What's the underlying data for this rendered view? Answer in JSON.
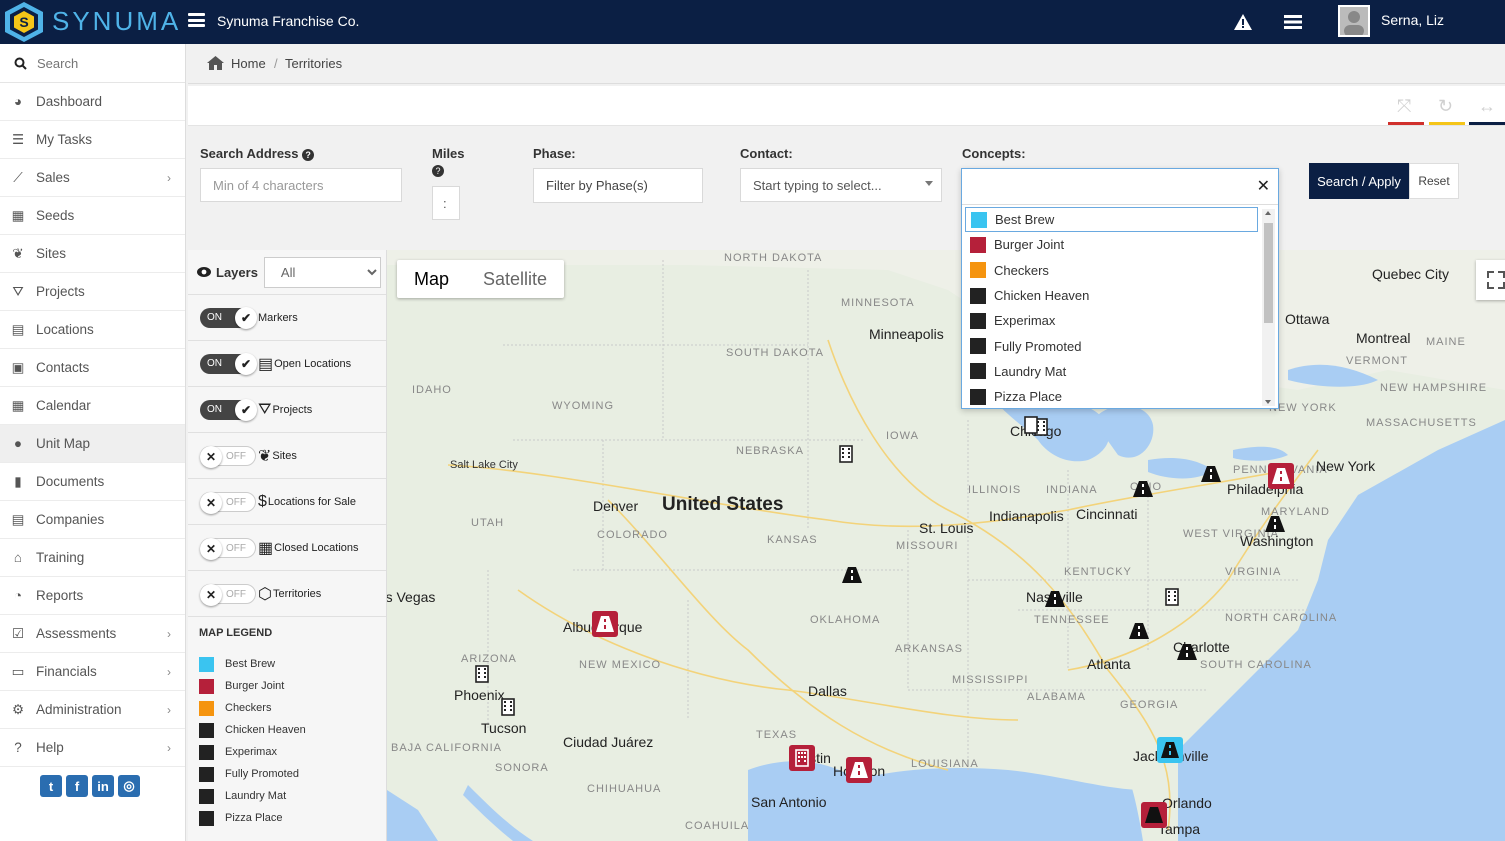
{
  "app": {
    "logo_text": "SYNUMA",
    "company": "Synuma Franchise Co.",
    "user": "Serna, Liz"
  },
  "sidebar": {
    "search_placeholder": "Search",
    "items": [
      {
        "label": "Dashboard",
        "icon": "dashboard-icon"
      },
      {
        "label": "My Tasks",
        "icon": "tasks-icon"
      },
      {
        "label": "Sales",
        "icon": "chart-line-icon",
        "chevron": true
      },
      {
        "label": "Seeds",
        "icon": "grid-icon"
      },
      {
        "label": "Sites",
        "icon": "leaf-icon"
      },
      {
        "label": "Projects",
        "icon": "road-icon"
      },
      {
        "label": "Locations",
        "icon": "building-icon"
      },
      {
        "label": "Contacts",
        "icon": "contact-icon"
      },
      {
        "label": "Calendar",
        "icon": "calendar-icon"
      },
      {
        "label": "Unit Map",
        "icon": "globe-icon",
        "active": true
      },
      {
        "label": "Documents",
        "icon": "file-icon"
      },
      {
        "label": "Companies",
        "icon": "building-icon"
      },
      {
        "label": "Training",
        "icon": "graduation-cap-icon"
      },
      {
        "label": "Reports",
        "icon": "pie-chart-icon"
      },
      {
        "label": "Assessments",
        "icon": "check-square-icon",
        "chevron": true
      },
      {
        "label": "Financials",
        "icon": "money-icon",
        "chevron": true
      },
      {
        "label": "Administration",
        "icon": "cogs-icon",
        "chevron": true
      },
      {
        "label": "Help",
        "icon": "question-icon",
        "chevron": true
      }
    ],
    "social": [
      "twitter-icon",
      "facebook-icon",
      "linkedin-icon",
      "instagram-icon"
    ]
  },
  "breadcrumb": {
    "home": "Home",
    "current": "Territories"
  },
  "filters": {
    "search_address": {
      "label": "Search Address",
      "placeholder": "Min of 4 characters"
    },
    "miles": {
      "label": "Miles",
      "value": ":"
    },
    "phase": {
      "label": "Phase:",
      "placeholder": "Filter by Phase(s)"
    },
    "contact": {
      "label": "Contact:",
      "placeholder": "Start typing to select..."
    },
    "concepts": {
      "label": "Concepts:",
      "value": ""
    },
    "apply_label": "Search / Apply",
    "reset_label": "Reset"
  },
  "concepts_dropdown": [
    {
      "label": "Best Brew",
      "color": "#3ac4f0",
      "selected": true
    },
    {
      "label": "Burger Joint",
      "color": "#b5203a"
    },
    {
      "label": "Checkers",
      "color": "#f5940f"
    },
    {
      "label": "Chicken Heaven",
      "color": "#222222"
    },
    {
      "label": "Experimax",
      "color": "#222222"
    },
    {
      "label": "Fully Promoted",
      "color": "#222222"
    },
    {
      "label": "Laundry Mat",
      "color": "#222222"
    },
    {
      "label": "Pizza Place",
      "color": "#222222"
    }
  ],
  "layers": {
    "title": "Layers",
    "filter_value": "All",
    "on_text": "ON",
    "off_text": "OFF",
    "rows": [
      {
        "label": "Markers",
        "on": true,
        "icon": ""
      },
      {
        "label": "Open Locations",
        "on": true,
        "icon": "building-icon"
      },
      {
        "label": "Projects",
        "on": true,
        "icon": "road-icon"
      },
      {
        "label": "Sites",
        "on": false,
        "icon": "leaf-icon"
      },
      {
        "label": "Locations for Sale",
        "on": false,
        "icon": "dollar-icon"
      },
      {
        "label": "Closed Locations",
        "on": false,
        "icon": "building-closed-icon"
      },
      {
        "label": "Territories",
        "on": false,
        "icon": "polygon-icon"
      }
    ]
  },
  "legend": {
    "title": "MAP LEGEND",
    "items": [
      {
        "label": "Best Brew",
        "color": "#3ac4f0"
      },
      {
        "label": "Burger Joint",
        "color": "#b5203a"
      },
      {
        "label": "Checkers",
        "color": "#f5940f"
      },
      {
        "label": "Chicken Heaven",
        "color": "#222222"
      },
      {
        "label": "Experimax",
        "color": "#222222"
      },
      {
        "label": "Fully Promoted",
        "color": "#222222"
      },
      {
        "label": "Laundry Mat",
        "color": "#222222"
      },
      {
        "label": "Pizza Place",
        "color": "#222222"
      }
    ]
  },
  "map": {
    "type_map": "Map",
    "type_satellite": "Satellite",
    "country": "United States",
    "labels": [
      "NORTH DAKOTA",
      "MINNESOTA",
      "SOUTH DAKOTA",
      "WYOMING",
      "IDAHO",
      "NEBRASKA",
      "IOWA",
      "UTAH",
      "COLORADO",
      "KANSAS",
      "MISSOURI",
      "ILLINOIS",
      "INDIANA",
      "OHIO",
      "OKLAHOMA",
      "ARKANSAS",
      "TENNESSEE",
      "KENTUCKY",
      "VIRGINIA",
      "WEST VIRGINIA",
      "NORTH CAROLINA",
      "SOUTH CAROLINA",
      "GEORGIA",
      "ALABAMA",
      "MISSISSIPPI",
      "LOUISIANA",
      "TEXAS",
      "NEW MEXICO",
      "ARIZONA",
      "PENNSYLVANIA",
      "MARYLAND",
      "NEW YORK",
      "VERMONT",
      "MAINE",
      "NEW HAMPSHIRE",
      "MASSACHUSETTS",
      "SONORA",
      "CHIHUAHUA",
      "COAHUILA",
      "BAJA CALIFORNIA"
    ],
    "cities": [
      "Minneapolis",
      "Chicago",
      "Salt Lake City",
      "Denver",
      "St. Louis",
      "Indianapolis",
      "Cincinnati",
      "Washington",
      "Philadelphia",
      "New York",
      "Ottawa",
      "Montreal",
      "Quebec City",
      "Nashville",
      "Charlotte",
      "Atlanta",
      "Dallas",
      "Houston",
      "Austin",
      "San Antonio",
      "Albuquerque",
      "Phoenix",
      "Tucson",
      "Las Vegas",
      "Ciudad Juárez",
      "Jacksonville",
      "Orlando",
      "Tampa"
    ]
  }
}
